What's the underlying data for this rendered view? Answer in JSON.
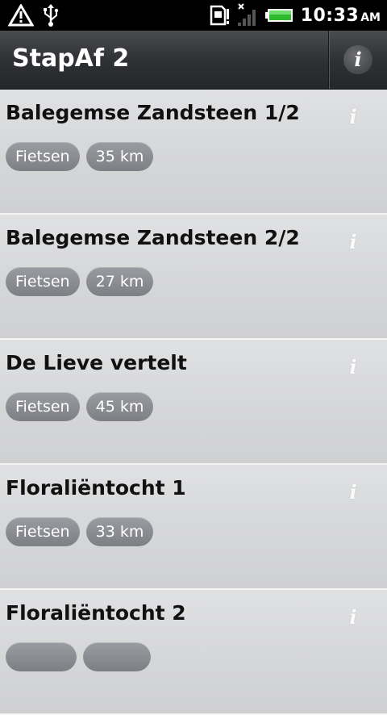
{
  "status_bar": {
    "time": "10:33",
    "ampm": "AM",
    "icons": [
      "warning-icon",
      "usb-icon",
      "sd-card-icon",
      "no-signal-icon",
      "battery-icon"
    ]
  },
  "header": {
    "title": "StapAf 2",
    "info_label": "i"
  },
  "routes": [
    {
      "title": "Balegemse Zandsteen 1/2",
      "type": "Fietsen",
      "distance": "35 km",
      "info": "i"
    },
    {
      "title": "Balegemse Zandsteen 2/2",
      "type": "Fietsen",
      "distance": "27 km",
      "info": "i"
    },
    {
      "title": "De Lieve vertelt",
      "type": "Fietsen",
      "distance": "45 km",
      "info": "i"
    },
    {
      "title": "Floraliëntocht 1",
      "type": "Fietsen",
      "distance": "33 km",
      "info": "i"
    },
    {
      "title": "Floraliëntocht 2",
      "type": "",
      "distance": "",
      "info": "i"
    }
  ],
  "colors": {
    "action_bar": "#2f3134",
    "tag_bg": "#8b8d92",
    "list_bg": "#d6d7d9"
  }
}
